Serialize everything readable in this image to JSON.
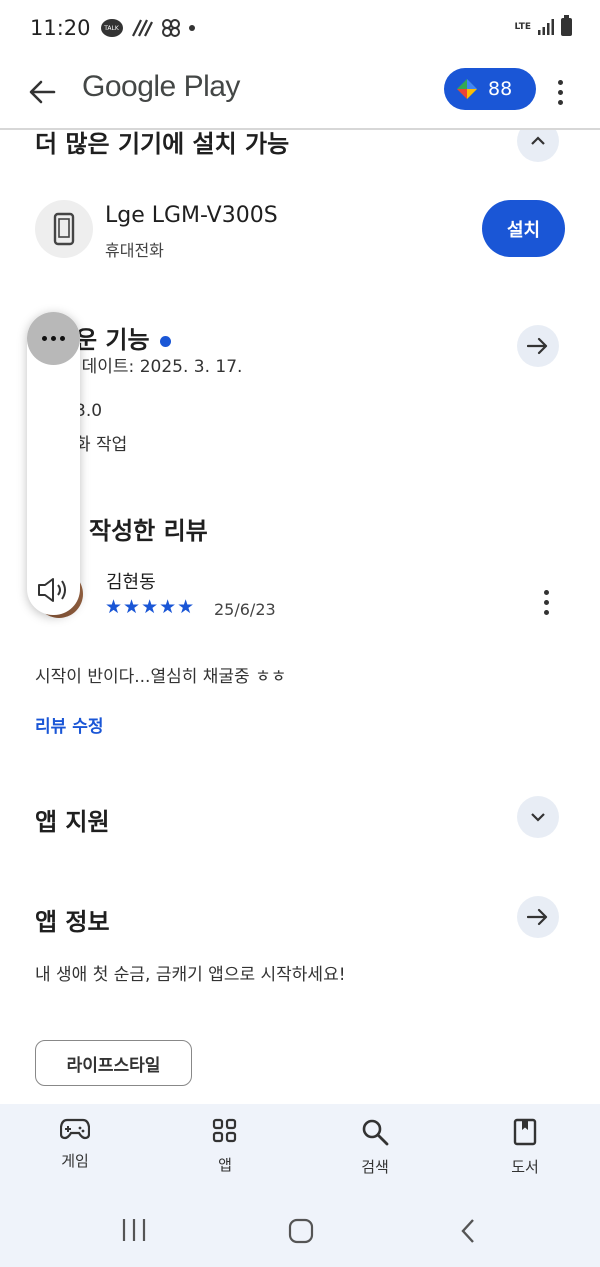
{
  "status_bar": {
    "time": "11:20",
    "talk_icon_text": "TALK",
    "network": "LTE"
  },
  "app_bar": {
    "title": "Google Play",
    "points": "88"
  },
  "device_section": {
    "title": "더 많은 기기에 설치 가능",
    "device_name": "Lge LGM-V300S",
    "device_type": "휴대전화",
    "install_label": "설치"
  },
  "whats_new": {
    "title": "운 기능",
    "updated": "업데이트: 2025. 3. 17.",
    "version": "3.0",
    "note": "화 작업"
  },
  "review_section": {
    "title": "작성한 리뷰",
    "reviewer": "김현동",
    "stars": "★★★★★",
    "rating": 5,
    "date": "25/6/23",
    "text": "시작이 반이다...열심히 채굴중 ㅎㅎ",
    "edit_label": "리뷰 수정"
  },
  "app_support": {
    "title": "앱 지원"
  },
  "app_info": {
    "title": "앱 정보",
    "description": "내 생애 첫 순금, 금캐기 앱으로 시작하세요!",
    "category_chip": "라이프스타일"
  },
  "bottom_nav": {
    "items": [
      {
        "label": "게임",
        "icon": "gamepad-icon"
      },
      {
        "label": "앱",
        "icon": "apps-grid-icon"
      },
      {
        "label": "검색",
        "icon": "search-icon"
      },
      {
        "label": "도서",
        "icon": "book-icon"
      }
    ]
  },
  "colors": {
    "accent": "#1a56d6",
    "nav_bg": "#eff3fa",
    "circle_btn": "#e8edf5"
  }
}
